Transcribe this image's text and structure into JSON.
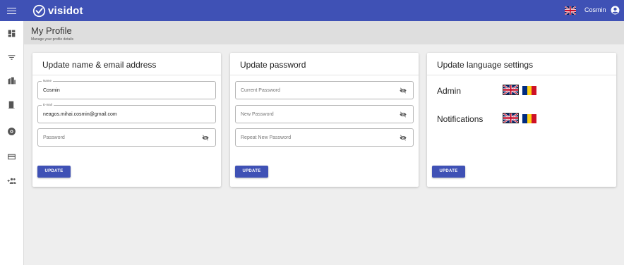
{
  "app": {
    "brand": "visidot",
    "user_name": "Cosmin"
  },
  "page": {
    "title": "My Profile",
    "subtitle": "Manage your profile details"
  },
  "name_card": {
    "title": "Update name & email address",
    "name_label": "Name",
    "name_value": "Cosmin",
    "email_label": "E-mail",
    "email_value": "neagos.mihai.cosmin@gmail.com",
    "password_placeholder": "Password",
    "button": "UPDATE"
  },
  "password_card": {
    "title": "Update password",
    "current_placeholder": "Current Password",
    "new_placeholder": "New Password",
    "repeat_placeholder": "Repeat New Password",
    "button": "UPDATE"
  },
  "language_card": {
    "title": "Update language settings",
    "rows": [
      {
        "label": "Admin",
        "selected": "en",
        "options": [
          "en",
          "ro"
        ]
      },
      {
        "label": "Notifications",
        "selected": "en",
        "options": [
          "en",
          "ro"
        ]
      }
    ],
    "button": "UPDATE"
  },
  "sidebar": {
    "items": [
      "dashboard-icon",
      "filter-icon",
      "buildings-icon",
      "door-icon",
      "badge-icon",
      "card-icon",
      "add-group-icon"
    ]
  },
  "colors": {
    "primary": "#3f51b5",
    "background": "#eeeeee",
    "header_band": "#dedede"
  }
}
